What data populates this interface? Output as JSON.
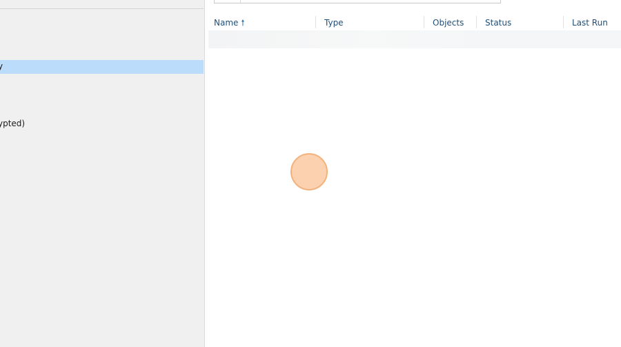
{
  "tree": {
    "items": [
      {
        "label": "y",
        "selected": true
      },
      {
        "label": "ypted)",
        "selected": false
      }
    ]
  },
  "grid": {
    "columns": [
      {
        "label": "Name",
        "sorted": "ascending"
      },
      {
        "label": "Type"
      },
      {
        "label": "Objects"
      },
      {
        "label": "Status"
      },
      {
        "label": "Last Run"
      }
    ],
    "sort_glyph": "🠕"
  },
  "colors": {
    "selection": "#bcdcfb",
    "header_text": "#1f4e79",
    "click_indicator": "#fbd1b0"
  }
}
